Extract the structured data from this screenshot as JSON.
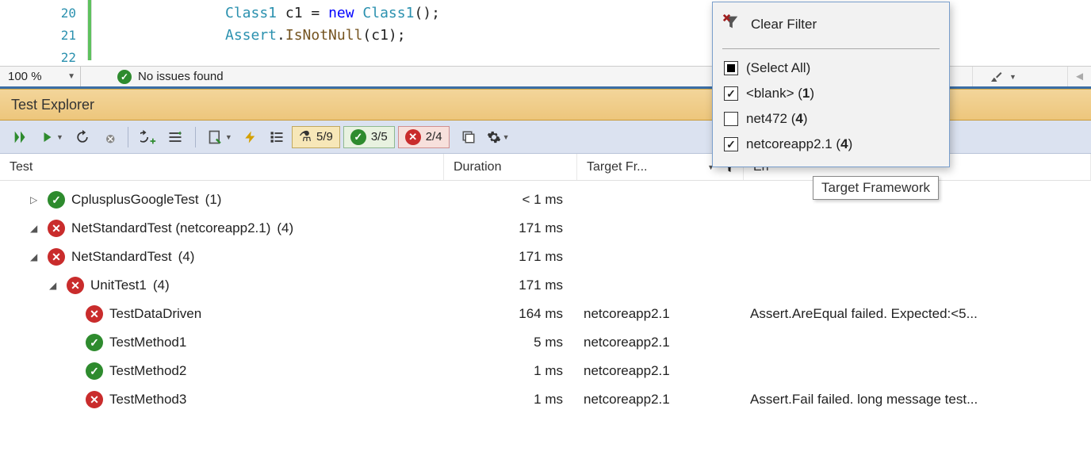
{
  "editor": {
    "lines": [
      {
        "num": "20",
        "html": "<span class='typ'>Class1</span> c1 = <span class='kw'>new</span> <span class='typ'>Class1</span>();"
      },
      {
        "num": "21",
        "html": "<span class='typ'>Assert</span>.<span class='mth2'>IsNotNull</span>(c1);"
      },
      {
        "num": "22",
        "html": ""
      }
    ]
  },
  "status_bar": {
    "zoom": "100 %",
    "message": "No issues found"
  },
  "panel_title": "Test Explorer",
  "toolbar": {
    "counts": {
      "total": "5/9",
      "pass": "3/5",
      "fail": "2/4"
    }
  },
  "columns": {
    "test": "Test",
    "duration": "Duration",
    "target": "Target Fr...",
    "error": "Err"
  },
  "tree": [
    {
      "indent": 0,
      "exp": "▷",
      "status": "pass",
      "name": "CplusplusGoogleTest",
      "count": "(1)",
      "duration": "< 1 ms",
      "target": "",
      "error": ""
    },
    {
      "indent": 0,
      "exp": "◢",
      "status": "fail",
      "name": "NetStandardTest (netcoreapp2.1)",
      "count": "(4)",
      "duration": "171 ms",
      "target": "",
      "error": ""
    },
    {
      "indent": 1,
      "exp": "◢",
      "status": "fail",
      "name": "NetStandardTest",
      "count": "(4)",
      "duration": "171 ms",
      "target": "",
      "error": ""
    },
    {
      "indent": 2,
      "exp": "◢",
      "status": "fail",
      "name": "UnitTest1",
      "count": "(4)",
      "duration": "171 ms",
      "target": "",
      "error": ""
    },
    {
      "indent": 3,
      "exp": "",
      "status": "fail",
      "name": "TestDataDriven",
      "count": "",
      "duration": "164 ms",
      "target": "netcoreapp2.1",
      "error": "Assert.AreEqual failed. Expected:<5..."
    },
    {
      "indent": 3,
      "exp": "",
      "status": "pass",
      "name": "TestMethod1",
      "count": "",
      "duration": "5 ms",
      "target": "netcoreapp2.1",
      "error": ""
    },
    {
      "indent": 3,
      "exp": "",
      "status": "pass",
      "name": "TestMethod2",
      "count": "",
      "duration": "1 ms",
      "target": "netcoreapp2.1",
      "error": ""
    },
    {
      "indent": 3,
      "exp": "",
      "status": "fail",
      "name": "TestMethod3",
      "count": "",
      "duration": "1 ms",
      "target": "netcoreapp2.1",
      "error": "Assert.Fail failed. long message test..."
    }
  ],
  "filter_popup": {
    "clear": "Clear Filter",
    "items": [
      {
        "check": "blk",
        "label_pre": "(Select All)",
        "label_bold": ""
      },
      {
        "check": "on",
        "label_pre": "<blank> (",
        "label_bold": "1",
        "label_post": ")"
      },
      {
        "check": "off",
        "label_pre": "net472 (",
        "label_bold": "4",
        "label_post": ")"
      },
      {
        "check": "on",
        "label_pre": "netcoreapp2.1 (",
        "label_bold": "4",
        "label_post": ")"
      }
    ]
  },
  "tooltip": "Target Framework"
}
